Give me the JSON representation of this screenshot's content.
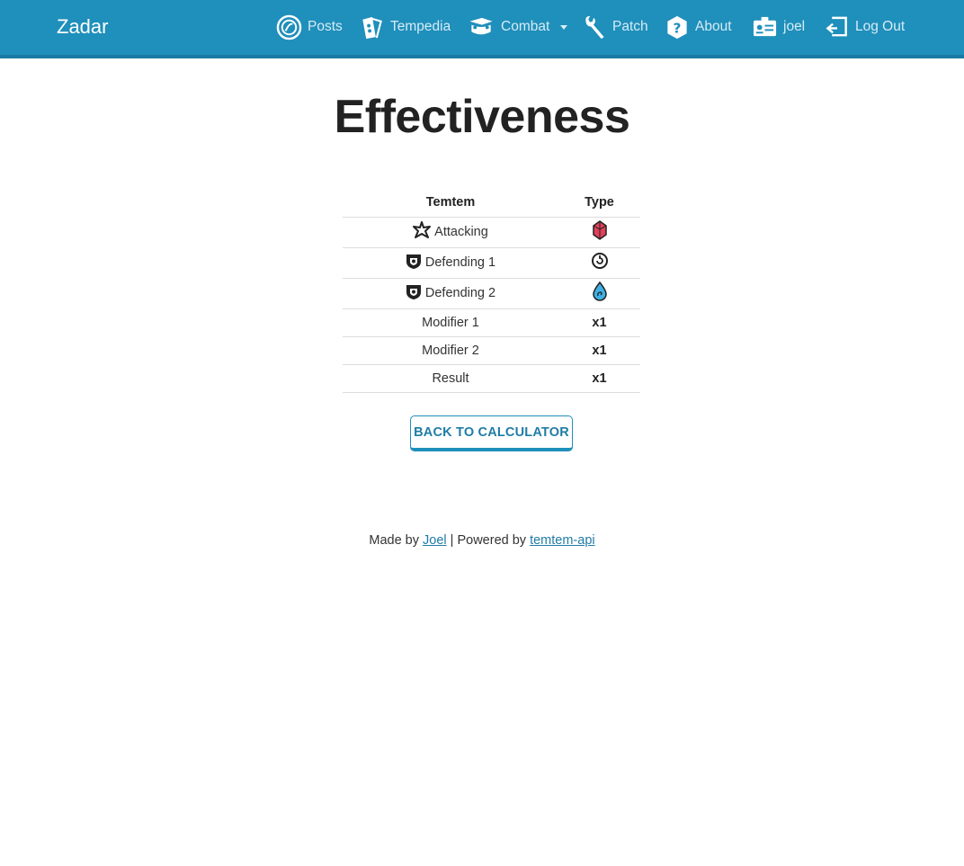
{
  "navbar": {
    "brand": "Zadar",
    "items": [
      {
        "label": "Posts",
        "icon": "posts-icon"
      },
      {
        "label": "Tempedia",
        "icon": "tempedia-icon"
      },
      {
        "label": "Combat",
        "icon": "combat-icon",
        "dropdown": true
      },
      {
        "label": "Patch",
        "icon": "wrench-icon"
      },
      {
        "label": "About",
        "icon": "question-icon"
      },
      {
        "label": "joel",
        "icon": "id-card-icon"
      },
      {
        "label": "Log Out",
        "icon": "logout-icon"
      }
    ],
    "background": "#1f8fbb"
  },
  "page": {
    "title": "Effectiveness"
  },
  "table": {
    "headers": [
      "Temtem",
      "Type"
    ],
    "rows": [
      {
        "label": "Attacking",
        "icon": "attack-icon",
        "type": "crystal-type-icon"
      },
      {
        "label": "Defending 1",
        "icon": "shield-icon",
        "type": "mental-type-icon"
      },
      {
        "label": "Defending 2",
        "icon": "shield-icon",
        "type": "water-type-icon"
      },
      {
        "label": "Modifier 1",
        "value": "x1"
      },
      {
        "label": "Modifier 2",
        "value": "x1"
      },
      {
        "label": "Result",
        "value": "x1"
      }
    ]
  },
  "button": {
    "label": "BACK TO CALCULATOR"
  },
  "footer": {
    "made_by": "Made by",
    "author": "Joel",
    "separator": "| Powered by",
    "api": "temtem-api"
  },
  "colors": {
    "accent": "#1f8fbb",
    "link": "#1f7ca6",
    "crystal": "#e0405a",
    "water": "#3fb0e6"
  }
}
